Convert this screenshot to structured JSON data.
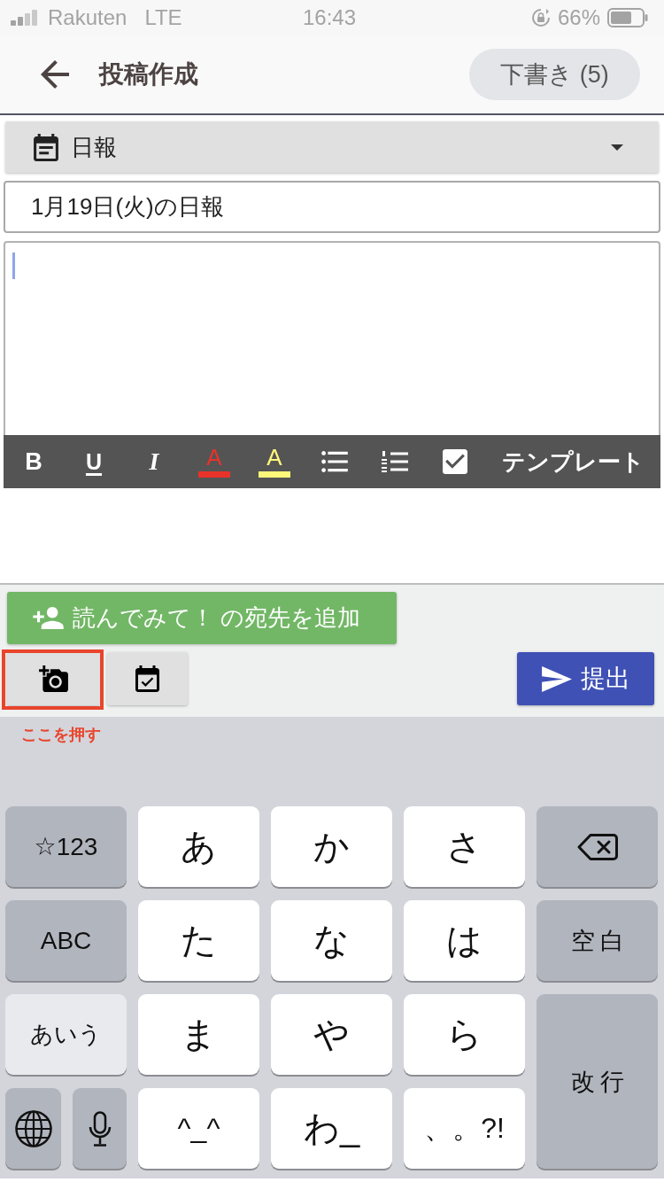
{
  "status_bar": {
    "carrier": "Rakuten",
    "network": "LTE",
    "time": "16:43",
    "battery": "66%"
  },
  "header": {
    "title": "投稿作成",
    "drafts_button": "下書き (5)"
  },
  "category_select": {
    "value": "日報"
  },
  "title_field": {
    "value": "1月19日(火)の日報"
  },
  "body_field": {
    "focused": true
  },
  "format_toolbar": {
    "tools": [
      {
        "kind": "bold",
        "label": "B"
      },
      {
        "kind": "underline",
        "label": "U"
      },
      {
        "kind": "italic",
        "label": "I"
      },
      {
        "kind": "text_color",
        "label": "A",
        "color": "#e8332a"
      },
      {
        "kind": "highlight",
        "label": "A",
        "color": "#fff77a"
      },
      {
        "kind": "bullet_list"
      },
      {
        "kind": "numbered_list"
      },
      {
        "kind": "checklist"
      },
      {
        "kind": "template",
        "label": "テンプレート"
      }
    ]
  },
  "recipient_button": {
    "label": "読んでみて！ の宛先を追加"
  },
  "attachment_buttons": [
    {
      "kind": "photo",
      "highlighted": true
    },
    {
      "kind": "event",
      "highlighted": false
    }
  ],
  "submit_button": {
    "label": "提出"
  },
  "annotation": {
    "text": "ここを押す"
  },
  "keyboard": {
    "rows": [
      [
        {
          "kind": "mode",
          "label": "☆123",
          "selected": false
        },
        {
          "kind": "character",
          "label": "あ"
        },
        {
          "kind": "character",
          "label": "か"
        },
        {
          "kind": "character",
          "label": "さ"
        }
      ],
      [
        {
          "kind": "mode",
          "label": "ABC",
          "selected": false
        },
        {
          "kind": "character",
          "label": "た"
        },
        {
          "kind": "character",
          "label": "な"
        },
        {
          "kind": "character",
          "label": "は"
        }
      ],
      [
        {
          "kind": "mode",
          "label": "あいう",
          "selected": true
        },
        {
          "kind": "character",
          "label": "ま"
        },
        {
          "kind": "character",
          "label": "や"
        },
        {
          "kind": "character",
          "label": "ら"
        }
      ],
      [
        {
          "kind": "pair",
          "keys": [
            {
              "kind": "globe"
            },
            {
              "kind": "mic"
            }
          ]
        },
        {
          "kind": "symbol",
          "label": "^_^"
        },
        {
          "kind": "character",
          "label": "わ_"
        },
        {
          "kind": "symbol",
          "label": "、。?!"
        }
      ]
    ],
    "side_keys": [
      {
        "kind": "backspace"
      },
      {
        "kind": "function",
        "label": "空白"
      },
      {
        "kind": "function",
        "label": "改行"
      }
    ]
  }
}
